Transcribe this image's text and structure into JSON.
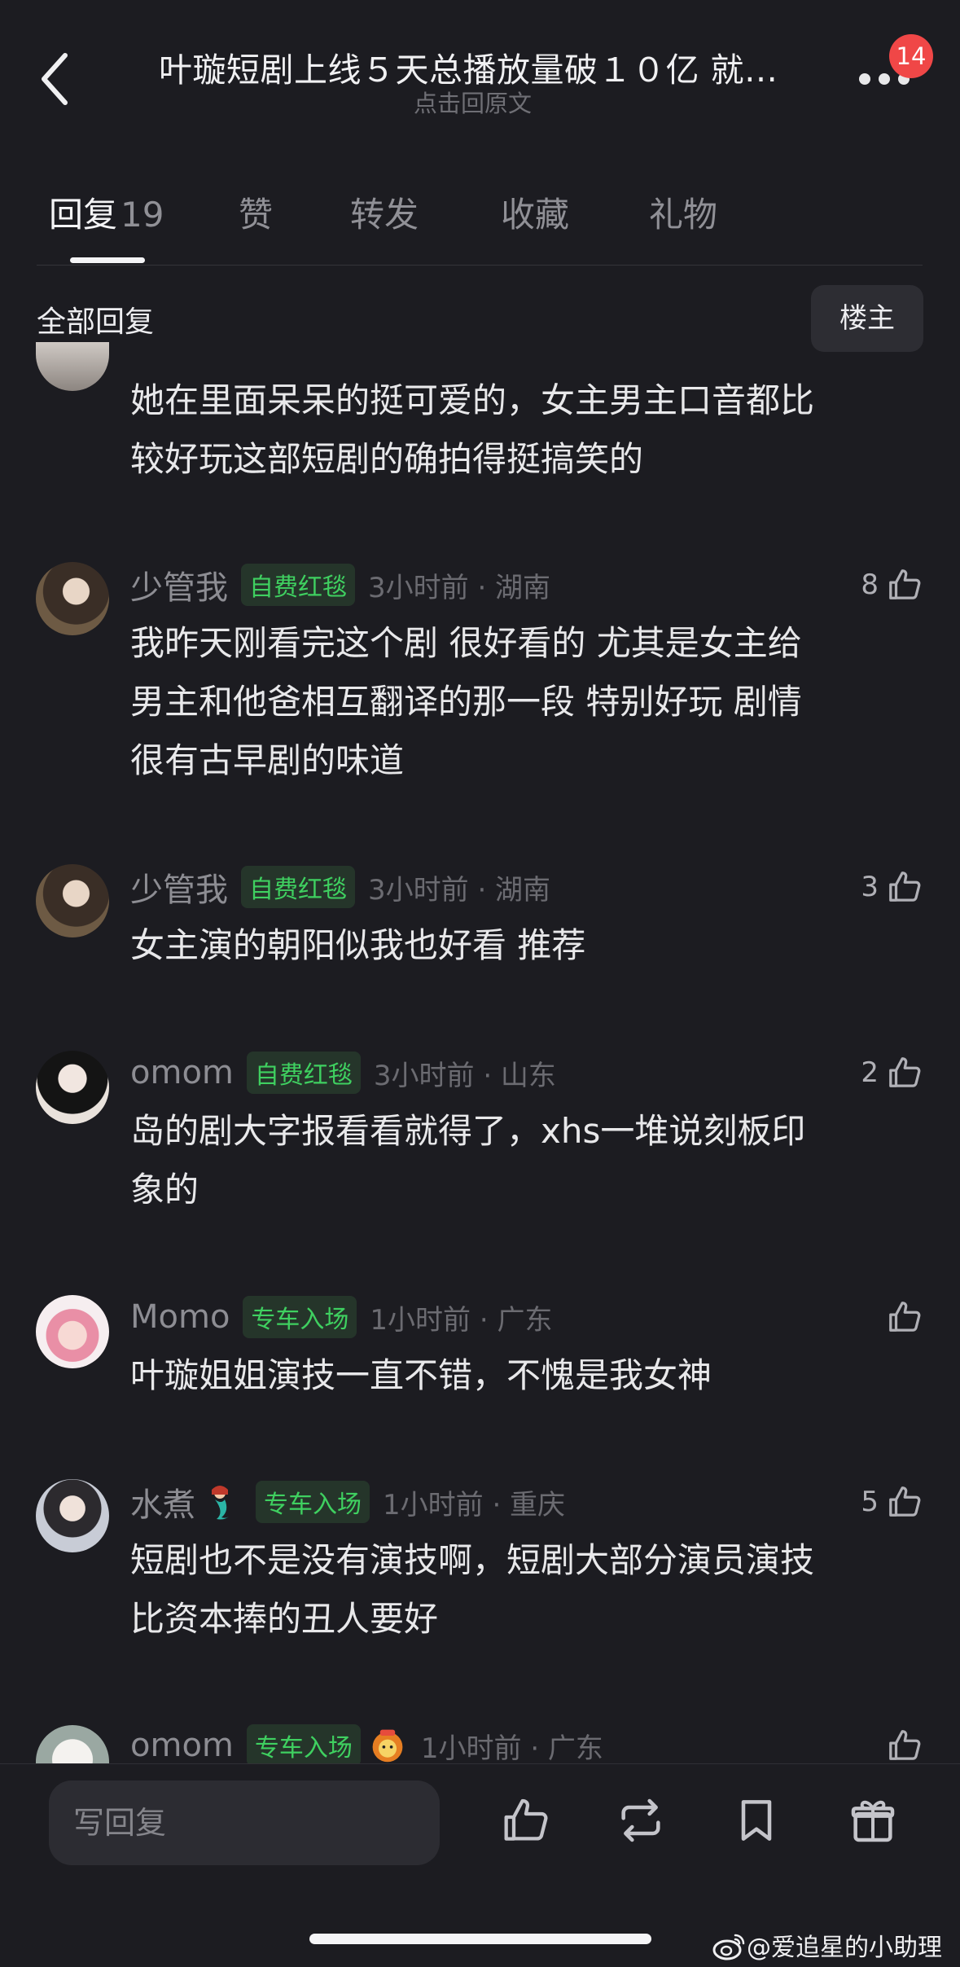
{
  "header": {
    "title": "叶璇短剧上线５天总播放量破１０亿 就…",
    "subtitle": "点击回原文",
    "notification_count": "14"
  },
  "tabs": [
    {
      "label": "回复",
      "count": "19"
    },
    {
      "label": "赞"
    },
    {
      "label": "转发"
    },
    {
      "label": "收藏"
    },
    {
      "label": "礼物"
    }
  ],
  "section": {
    "label": "全部回复",
    "op_button": "楼主"
  },
  "comments": [
    {
      "username": "",
      "badge": "",
      "time_location": "",
      "likes": "",
      "text": [
        "她在里面呆呆的挺可爱的，女主男主口音都比",
        "较好玩这部短剧的确拍得挺搞笑的"
      ]
    },
    {
      "username": "少管我",
      "badge": "自费红毯",
      "time_location": "3小时前 · 湖南",
      "likes": "8",
      "text": [
        "我昨天刚看完这个剧 很好看的 尤其是女主给",
        "男主和他爸相互翻译的那一段 特别好玩 剧情",
        "很有古早剧的味道"
      ]
    },
    {
      "username": "少管我",
      "badge": "自费红毯",
      "time_location": "3小时前 · 湖南",
      "likes": "3",
      "text": [
        "女主演的朝阳似我也好看 推荐"
      ]
    },
    {
      "username": "omom",
      "badge": "自费红毯",
      "time_location": "3小时前 · 山东",
      "likes": "2",
      "text": [
        "岛的剧大字报看看就得了，xhs一堆说刻板印",
        "象的"
      ]
    },
    {
      "username": "Momo",
      "badge": "专车入场",
      "time_location": "1小时前 · 广东",
      "likes": "",
      "text": [
        "叶璇姐姐演技一直不错，不愧是我女神"
      ]
    },
    {
      "username": "水煮",
      "badge": "专车入场",
      "time_location": "1小时前 · 重庆",
      "likes": "5",
      "text": [
        "短剧也不是没有演技啊，短剧大部分演员演技",
        "比资本捧的丑人要好"
      ]
    },
    {
      "username": "omom",
      "badge": "专车入场",
      "time_location": "1小时前 · 广东",
      "likes": "",
      "text": []
    }
  ],
  "bottom_bar": {
    "reply_placeholder": "写回复"
  },
  "watermark": "@爱追星的小助理",
  "colors": {
    "background": "#1c1c21",
    "badge_green": "#3fd060",
    "notification_red": "#f04747"
  },
  "icons": [
    "back-arrow-icon",
    "more-dots-icon",
    "thumbs-up-icon",
    "repost-icon",
    "bookmark-icon",
    "gift-icon",
    "weibo-logo-icon"
  ]
}
